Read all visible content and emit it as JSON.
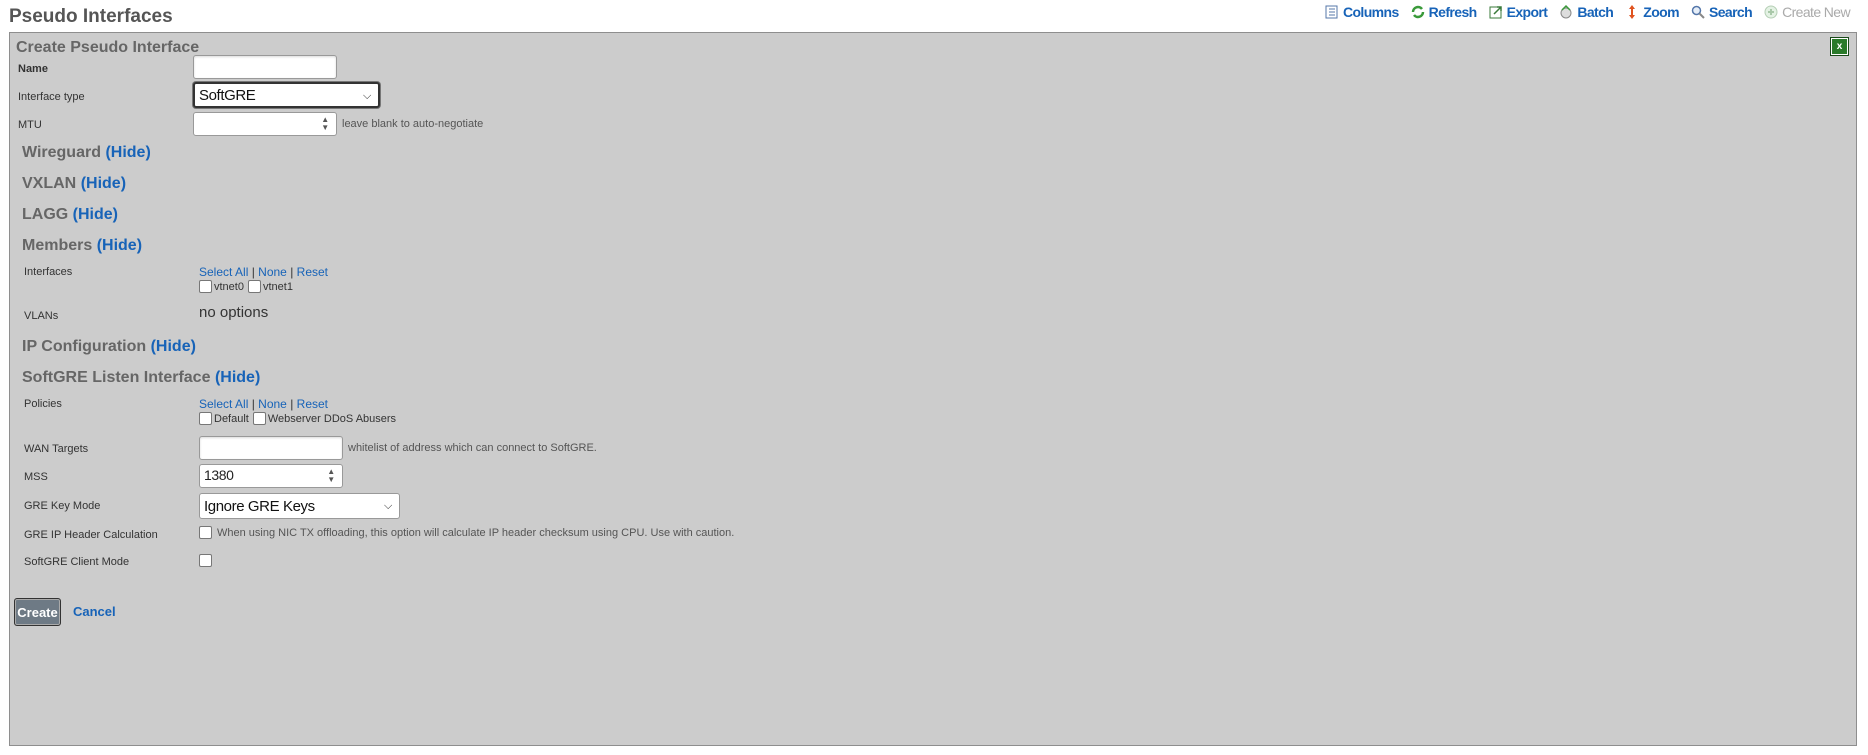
{
  "page_title": "Pseudo Interfaces",
  "toolbar": {
    "columns": "Columns",
    "refresh": "Refresh",
    "export": "Export",
    "batch": "Batch",
    "zoom": "Zoom",
    "search": "Search",
    "create_new": "Create New"
  },
  "panel": {
    "title": "Create Pseudo Interface",
    "close": "x"
  },
  "form": {
    "name_label": "Name",
    "name_value": "",
    "interface_type_label": "Interface type",
    "interface_type_value": "SoftGRE",
    "mtu_label": "MTU",
    "mtu_value": "",
    "mtu_hint": "leave blank to auto-negotiate"
  },
  "sections": {
    "wireguard": "Wireguard",
    "vxlan": "VXLAN",
    "lagg": "LAGG",
    "members": "Members",
    "ip_config": "IP Configuration",
    "softgre_listen": "SoftGRE Listen Interface",
    "hide": "(Hide)"
  },
  "members": {
    "interfaces_label": "Interfaces",
    "select_all": "Select All",
    "none": "None",
    "reset": "Reset",
    "sep": "|",
    "interfaces": [
      "vtnet0",
      "vtnet1"
    ],
    "vlans_label": "VLANs",
    "vlans_value": "no options"
  },
  "softgre": {
    "policies_label": "Policies",
    "policies": [
      "Default",
      "Webserver DDoS Abusers"
    ],
    "wan_targets_label": "WAN Targets",
    "wan_targets_value": "",
    "wan_targets_hint": "whitelist of address which can connect to SoftGRE.",
    "mss_label": "MSS",
    "mss_value": "1380",
    "gre_key_mode_label": "GRE Key Mode",
    "gre_key_mode_value": "Ignore GRE Keys",
    "gre_ip_header_label": "GRE IP Header Calculation",
    "gre_ip_header_hint": "When using NIC TX offloading, this option will calculate IP header checksum using CPU. Use with caution.",
    "client_mode_label": "SoftGRE Client Mode"
  },
  "actions": {
    "create": "Create",
    "cancel": "Cancel"
  }
}
